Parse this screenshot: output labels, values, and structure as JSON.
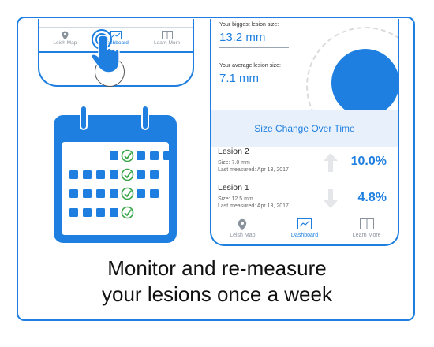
{
  "colors": {
    "accent": "#1e7fe0",
    "check": "#3aa64a",
    "band": "#e8f1fb"
  },
  "small_phone": {
    "tabs": [
      {
        "label": "Leish Map",
        "icon": "map-pin-icon",
        "active": false
      },
      {
        "label": "Dashboard",
        "icon": "chart-icon",
        "active": true
      },
      {
        "label": "Learn More",
        "icon": "book-icon",
        "active": false
      }
    ]
  },
  "dashboard": {
    "biggest_label": "Your biggest lesion size:",
    "biggest_value": "13.2 mm",
    "average_label": "Your average lesion size:",
    "average_value": "7.1 mm",
    "section_title": "Size Change Over Time",
    "lesions": [
      {
        "name": "Lesion 2",
        "size": "Size: 7.0 mm",
        "measured": "Last measured: Apr 13, 2017",
        "trend": "up",
        "percent": "10.0%"
      },
      {
        "name": "Lesion 1",
        "size": "Size: 12.5 mm",
        "measured": "Last measured: Apr 13, 2017",
        "trend": "down",
        "percent": "4.8%"
      }
    ],
    "tabs": [
      {
        "label": "Leish Map",
        "icon": "map-pin-icon",
        "active": false
      },
      {
        "label": "Dashboard",
        "icon": "chart-icon",
        "active": true
      },
      {
        "label": "Learn More",
        "icon": "book-icon",
        "active": false
      }
    ]
  },
  "caption": {
    "line1": "Monitor and re-measure",
    "line2": "your lesions once a week"
  }
}
